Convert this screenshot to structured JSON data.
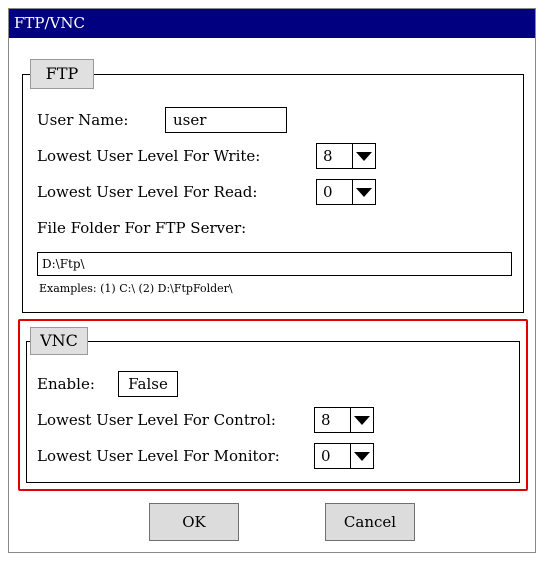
{
  "window": {
    "title": "FTP/VNC"
  },
  "ftp": {
    "legend": "FTP",
    "user_name_label": "User Name:",
    "user_name_value": "user",
    "write_level_label": "Lowest User Level For Write:",
    "write_level_value": "8",
    "read_level_label": "Lowest User Level For Read:",
    "read_level_value": "0",
    "folder_label": "File Folder For FTP Server:",
    "folder_value": "D:\\Ftp\\",
    "examples": "Examples:  (1) C:\\   (2) D:\\FtpFolder\\"
  },
  "vnc": {
    "legend": "VNC",
    "enable_label": "Enable:",
    "enable_value": "False",
    "control_level_label": "Lowest User Level For Control:",
    "control_level_value": "8",
    "monitor_level_label": "Lowest User Level For Monitor:",
    "monitor_level_value": "0"
  },
  "buttons": {
    "ok": "OK",
    "cancel": "Cancel"
  },
  "colors": {
    "titlebar": "#000080",
    "highlight": "#e00000",
    "legend_bg": "#e0e0e0",
    "button_bg": "#dcdcdc"
  }
}
